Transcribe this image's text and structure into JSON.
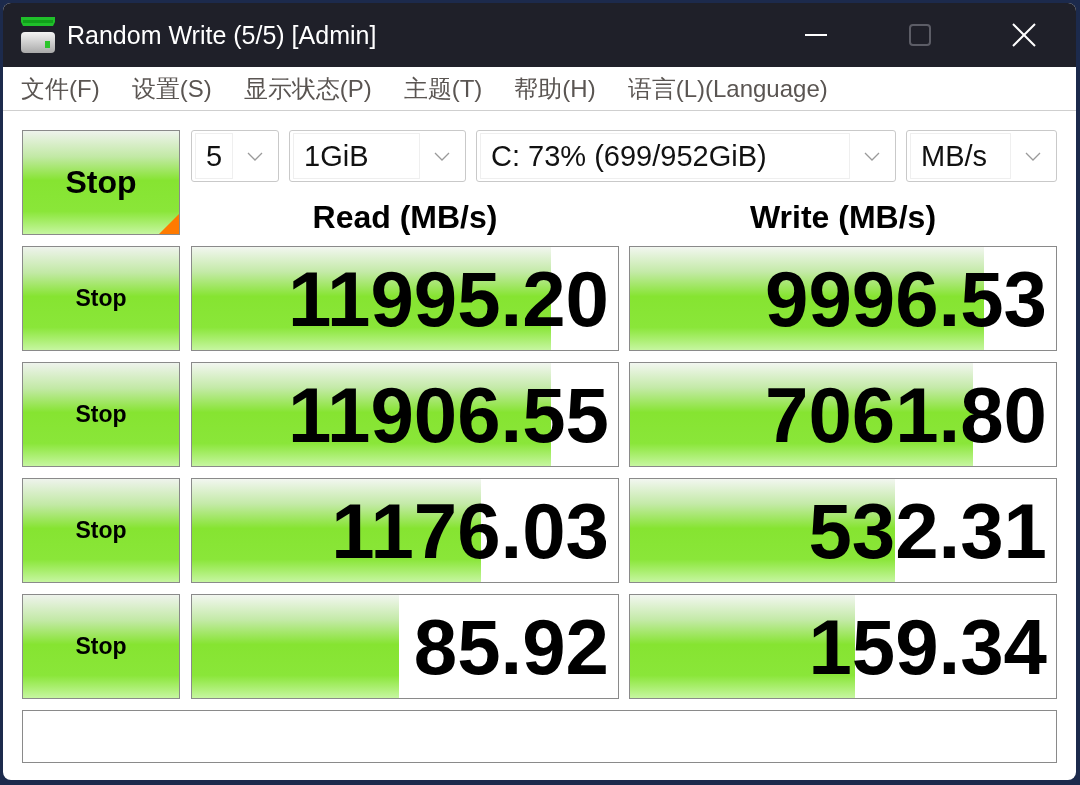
{
  "window": {
    "title": "Random Write (5/5) [Admin]",
    "controls": [
      {
        "kind": "minimize",
        "disabled": false
      },
      {
        "kind": "maximize",
        "disabled": true
      },
      {
        "kind": "close",
        "disabled": false
      }
    ]
  },
  "menu": [
    "文件(F)",
    "设置(S)",
    "显示状态(P)",
    "主题(T)",
    "帮助(H)",
    "语言(L)(Language)"
  ],
  "start_button": {
    "label": "Stop"
  },
  "selectors": [
    {
      "value": "5"
    },
    {
      "value": "1GiB"
    },
    {
      "value": "C: 73% (699/952GiB)"
    },
    {
      "value": "MB/s"
    }
  ],
  "columns": [
    "Read (MB/s)",
    "Write (MB/s)"
  ],
  "tests": [
    {
      "button": "Stop",
      "read": {
        "value": "11995.20",
        "level": 0.843
      },
      "write": {
        "value": "9996.53",
        "level": 0.832
      }
    },
    {
      "button": "Stop",
      "read": {
        "value": "11906.55",
        "level": 0.843
      },
      "write": {
        "value": "7061.80",
        "level": 0.806
      }
    },
    {
      "button": "Stop",
      "read": {
        "value": "1176.03",
        "level": 0.678
      },
      "write": {
        "value": "532.31",
        "level": 0.621
      }
    },
    {
      "button": "Stop",
      "read": {
        "value": "85.92",
        "level": 0.486
      },
      "write": {
        "value": "159.34",
        "level": 0.528
      }
    }
  ]
}
